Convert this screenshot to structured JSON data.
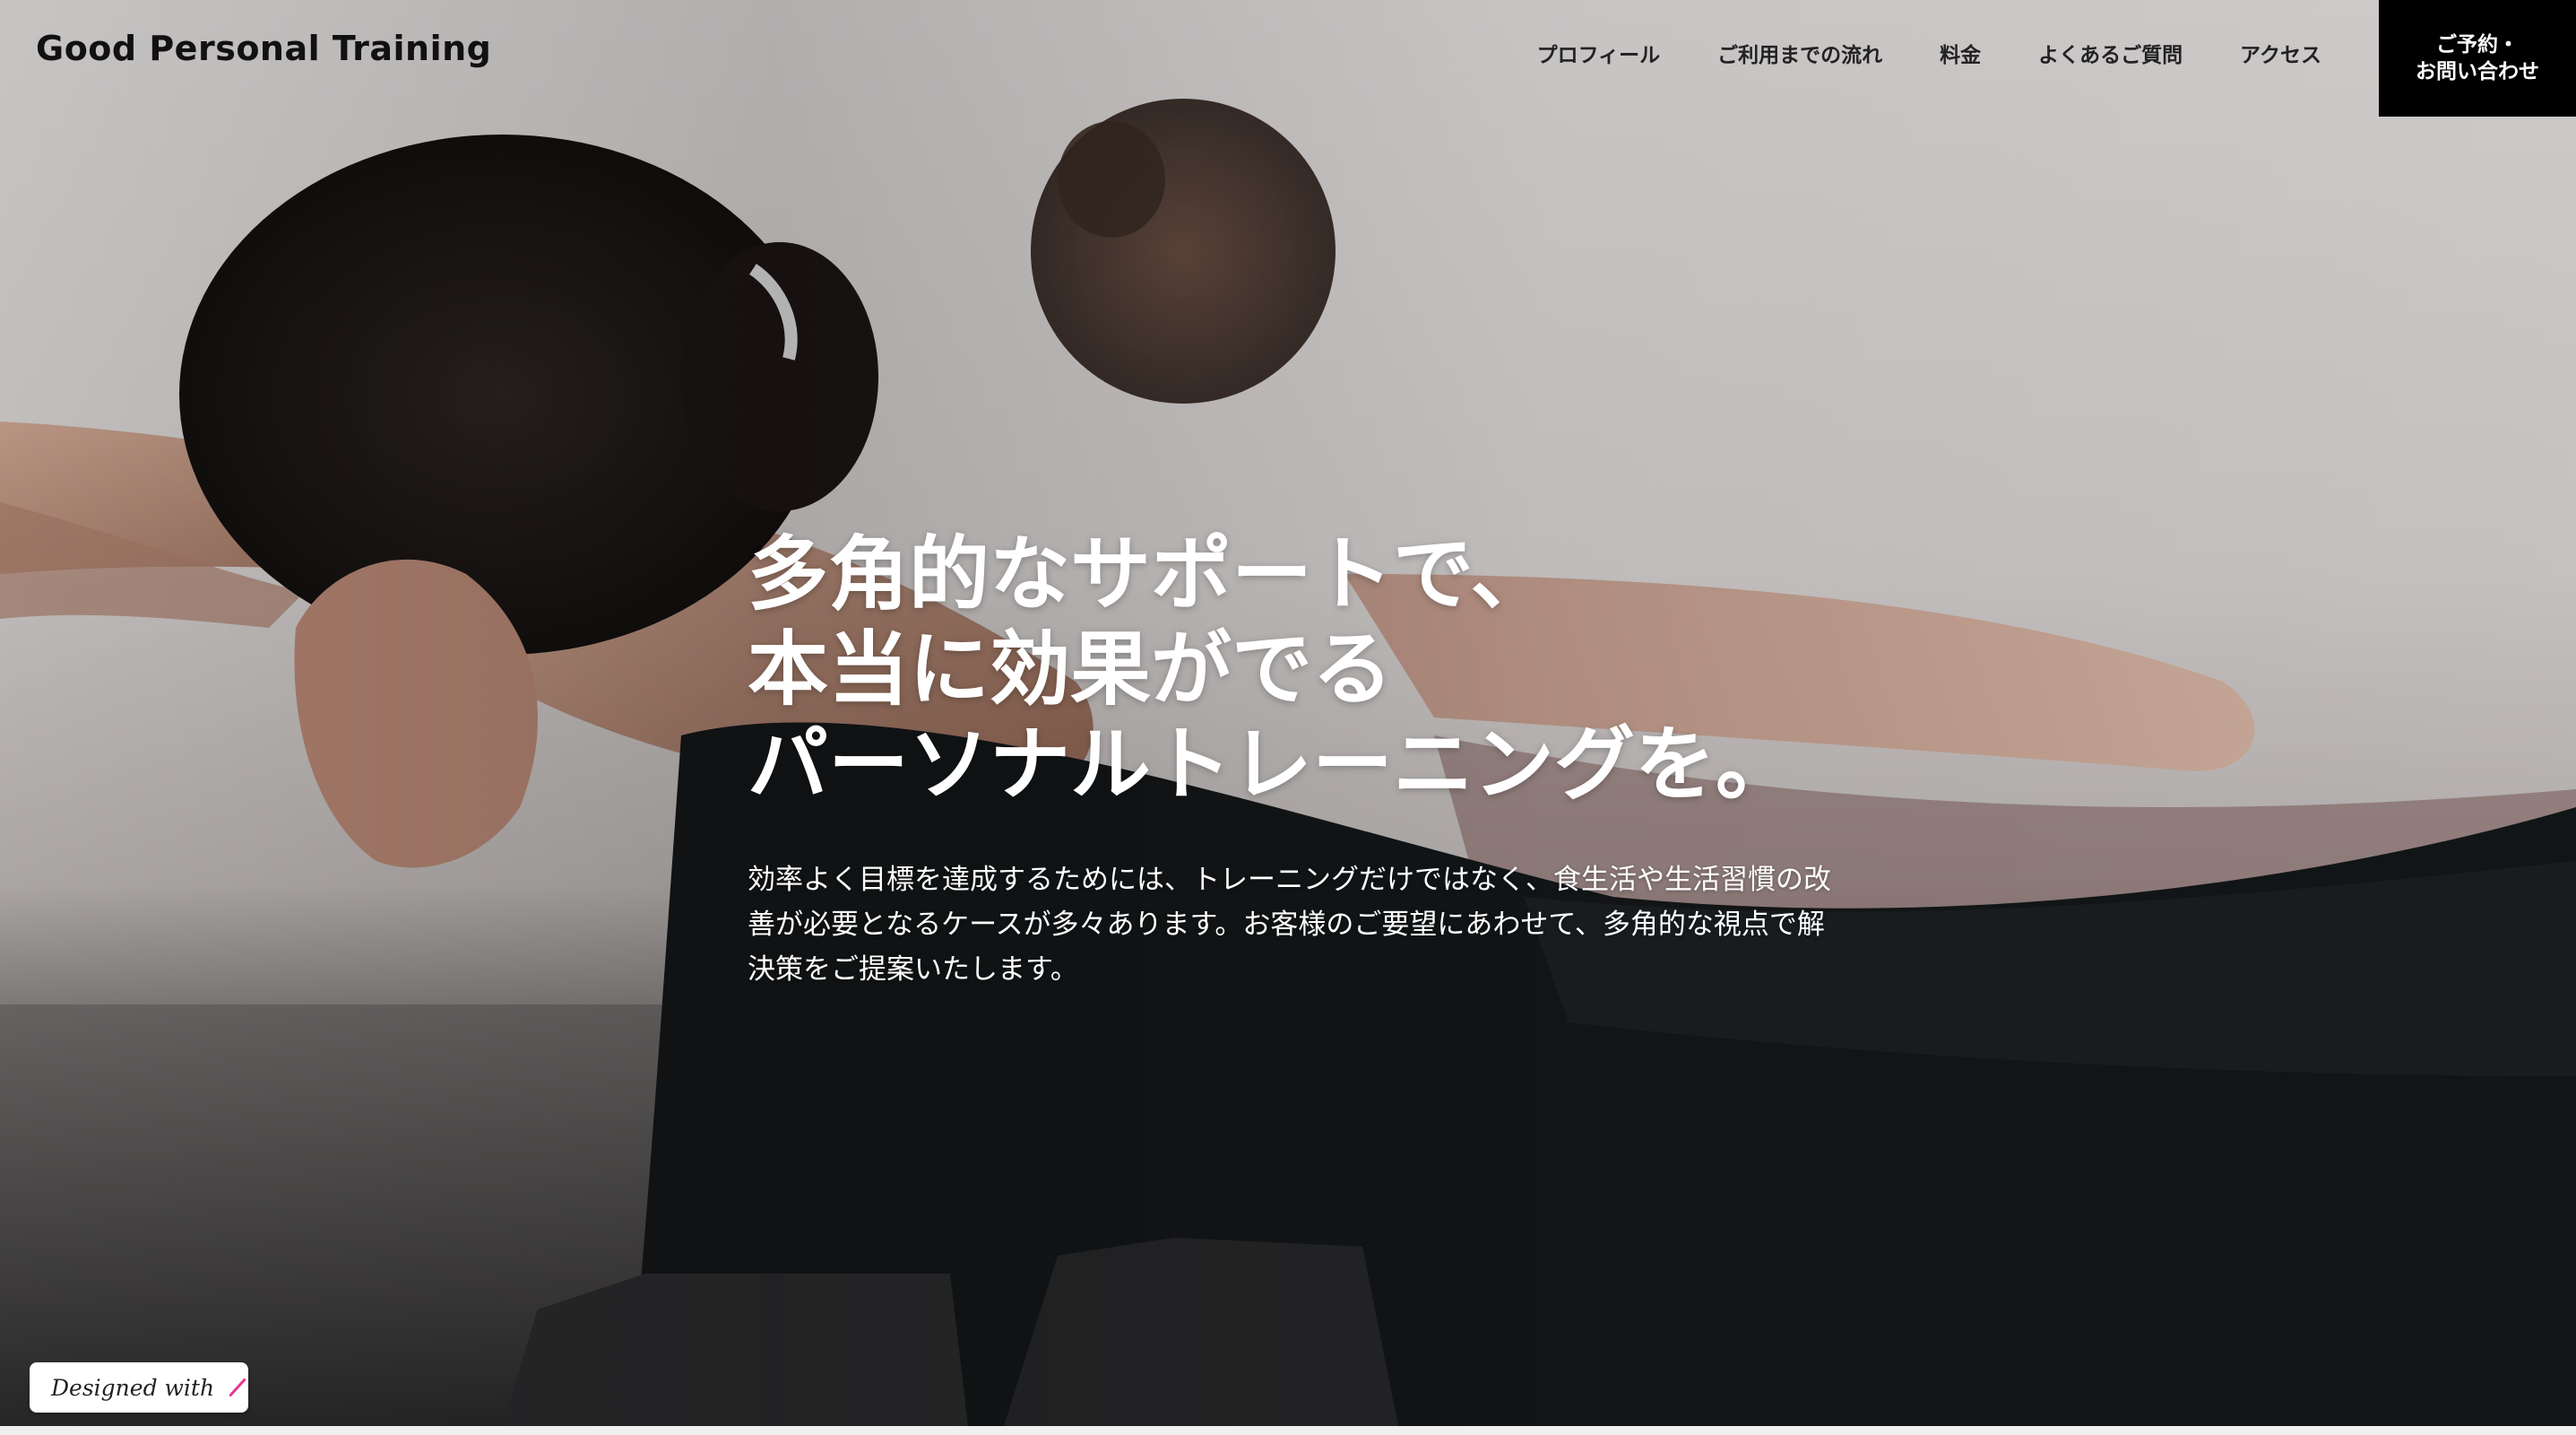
{
  "header": {
    "brand": "Good Personal Training",
    "nav": [
      {
        "label": "プロフィール"
      },
      {
        "label": "ご利用までの流れ"
      },
      {
        "label": "料金"
      },
      {
        "label": "よくあるご質問"
      },
      {
        "label": "アクセス"
      }
    ],
    "cta": {
      "line1": "ご予約・",
      "line2": "お問い合わせ"
    }
  },
  "hero": {
    "headline": [
      "多角的なサポートで、",
      "本当に効果がでる",
      "パーソナルトレーニングを。"
    ],
    "lead": "効率よく目標を達成するためには、トレーニングだけではなく、食生活や生活習慣の改善が必要となるケースが多々あります。お客様のご要望にあわせて、多角的な視点で解決策をご提案いたします。"
  },
  "badge": {
    "label": "Designed with",
    "icon": "pen-stroke-icon",
    "accent": "#e8368f"
  }
}
